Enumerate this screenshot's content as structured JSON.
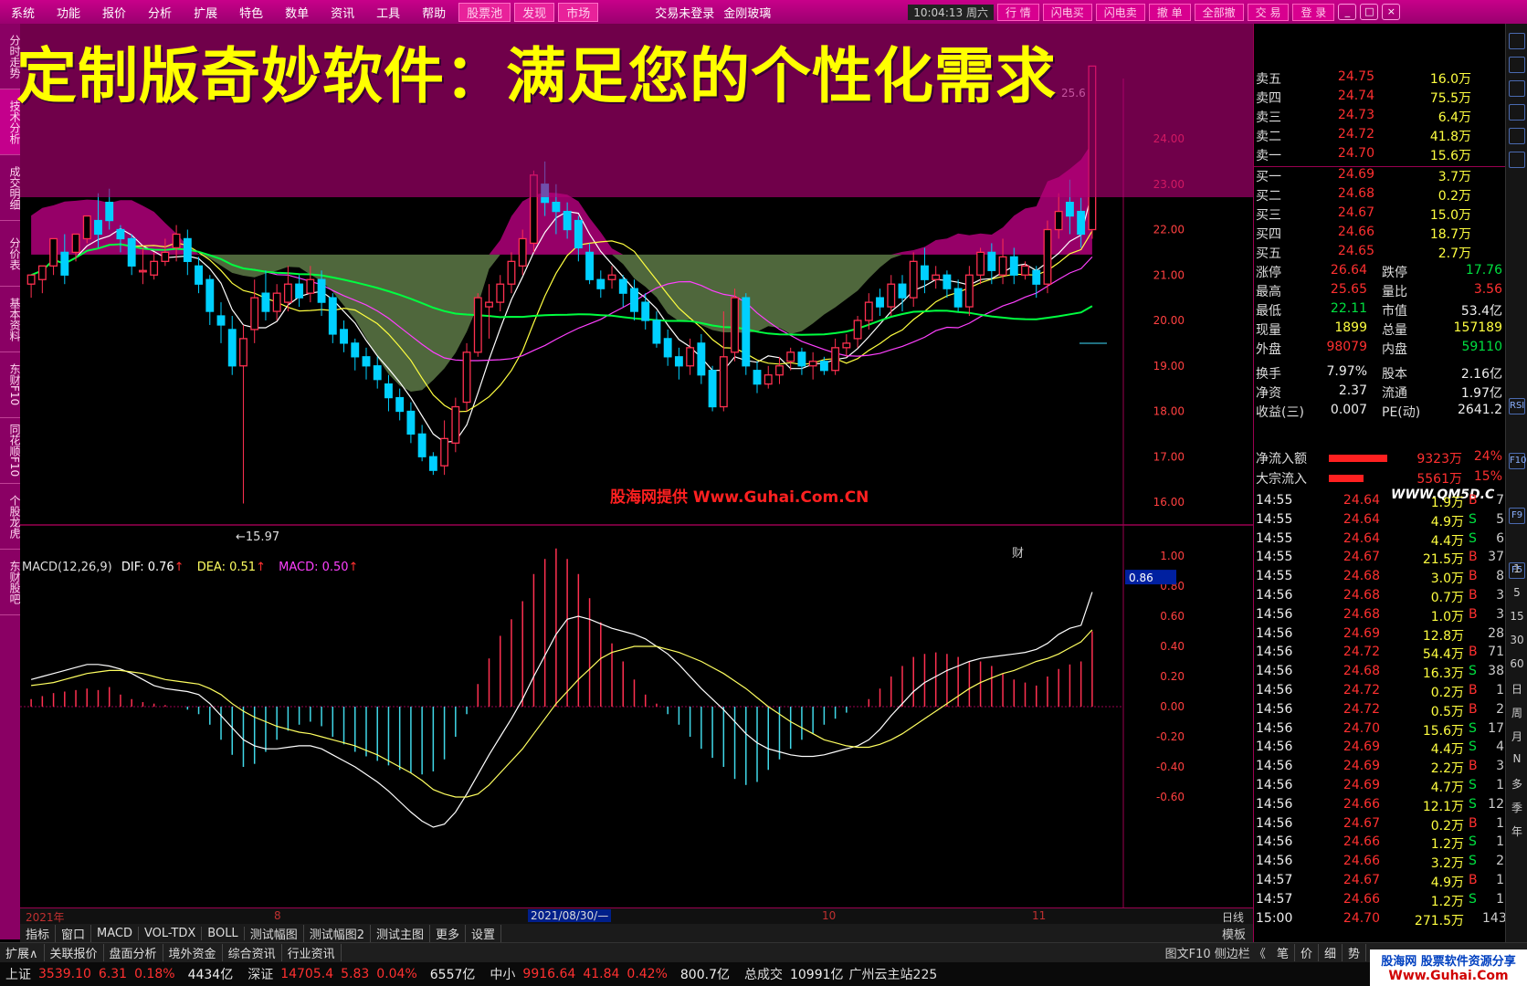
{
  "menu": {
    "items": [
      "系统",
      "功能",
      "报价",
      "分析",
      "扩展",
      "特色",
      "数单",
      "资讯",
      "工具",
      "帮助"
    ],
    "highlight_items": [
      "股票池",
      "发现",
      "市场"
    ],
    "login_status": "交易未登录",
    "stock_name": "金刚玻璃",
    "clock": "10:04:13 周六",
    "right_buttons": [
      "行 情",
      "闪电买",
      "闪电卖",
      "撤 单",
      "全部撤",
      "交 易",
      "登 录"
    ],
    "window_controls": [
      "_",
      "□",
      "×"
    ]
  },
  "left_tabs": [
    "分时走势",
    "技术分析",
    "成交明细",
    "分价表",
    "基本资料",
    "东财F10",
    "同花顺F10",
    "个股龙虎",
    "东财股吧"
  ],
  "banner": {
    "text": "定制版奇妙软件：满足您的个性化需求"
  },
  "chart": {
    "price_axis": [
      "24.00",
      "23.00",
      "22.00",
      "21.00",
      "20.00",
      "19.00",
      "18.00",
      "17.00",
      "16.00"
    ],
    "macd_axis": [
      "1.00",
      "0.80",
      "0.60",
      "0.40",
      "0.20",
      "0.00",
      "-0.20",
      "-0.40",
      "-0.60"
    ],
    "macd_current": "0.86",
    "top_label": "25.6",
    "low_label": "←15.97",
    "marker": "财",
    "watermark": "股海网提供 Www.Guhai.Com.CN",
    "macd_label": {
      "name": "MACD(12,26,9)",
      "dif": "DIF: 0.76",
      "dea": "DEA: 0.51",
      "macd": "MACD: 0.50",
      "arrow": "↑"
    },
    "x_labels": [
      "2021年",
      "8",
      "10",
      "11"
    ],
    "x_selected": "2021/08/30/—",
    "period_label": "日线",
    "colors": {
      "up": "#ff3050",
      "down": "#00d0ff",
      "ma5": "#ffffff",
      "ma10": "#ffff40",
      "ma20": "#ff40ff",
      "ma60": "#00ff40",
      "band_up": "#b0007a",
      "band_down": "#6a8a50"
    }
  },
  "tabs": [
    "指标",
    "窗口",
    "MACD",
    "VOL-TDX",
    "BOLL",
    "测试幅图",
    "测试幅图2",
    "测试主图",
    "更多",
    "设置"
  ],
  "tabs_right": "模板",
  "ext_tabs": [
    "扩展∧",
    "关联报价",
    "盘面分析",
    "境外资金",
    "综合资讯",
    "行业资讯"
  ],
  "ext_right": "图文F10 侧边栏 《",
  "ext_extra": [
    "笔",
    "价",
    "细",
    "势"
  ],
  "status": {
    "sh_label": "上证",
    "sh_value": "3539.10",
    "sh_change": "6.31",
    "sh_pct": "0.18%",
    "sh_amount": "4434亿",
    "sz_label": "深证",
    "sz_value": "14705.4",
    "sz_change": "5.83",
    "sz_pct": "0.04%",
    "sz_amount": "6557亿",
    "zx_label": "中小",
    "zx_value": "9916.64",
    "zx_change": "41.84",
    "zx_pct": "0.42%",
    "zx_amount": "800.7亿",
    "total_label": "总成交",
    "total_value": "10991亿",
    "site": "广州云主站225"
  },
  "brand": {
    "line1": "股海网 股票软件资源分享",
    "line2": "Www.Guhai.Com"
  },
  "quote": {
    "sells": [
      {
        "label": "卖五",
        "price": "24.75",
        "vol": "16.0万"
      },
      {
        "label": "卖四",
        "price": "24.74",
        "vol": "75.5万"
      },
      {
        "label": "卖三",
        "price": "24.73",
        "vol": "6.4万"
      },
      {
        "label": "卖二",
        "price": "24.72",
        "vol": "41.8万"
      },
      {
        "label": "卖一",
        "price": "24.70",
        "vol": "15.6万"
      }
    ],
    "buys": [
      {
        "label": "买一",
        "price": "24.69",
        "vol": "3.7万"
      },
      {
        "label": "买二",
        "price": "24.68",
        "vol": "0.2万"
      },
      {
        "label": "买三",
        "price": "24.67",
        "vol": "15.0万"
      },
      {
        "label": "买四",
        "price": "24.66",
        "vol": "18.7万"
      },
      {
        "label": "买五",
        "price": "24.65",
        "vol": "2.7万"
      }
    ],
    "stats": [
      {
        "l1": "涨停",
        "v1": "26.64",
        "c1": "#ff3030",
        "l2": "跌停",
        "v2": "17.76",
        "c2": "#00e040"
      },
      {
        "l1": "最高",
        "v1": "25.65",
        "c1": "#ff3030",
        "l2": "量比",
        "v2": "3.56",
        "c2": "#ff3030"
      },
      {
        "l1": "最低",
        "v1": "22.11",
        "c1": "#00e040",
        "l2": "市值",
        "v2": "53.4亿",
        "c2": "#eeeeee"
      },
      {
        "l1": "现量",
        "v1": "1899",
        "c1": "#ffff40",
        "l2": "总量",
        "v2": "157189",
        "c2": "#ffff40"
      },
      {
        "l1": "外盘",
        "v1": "98079",
        "c1": "#ff3030",
        "l2": "内盘",
        "v2": "59110",
        "c2": "#00e040"
      },
      {
        "l1": "换手",
        "v1": "7.97%",
        "c1": "#eeeeee",
        "l2": "股本",
        "v2": "2.16亿",
        "c2": "#eeeeee"
      },
      {
        "l1": "净资",
        "v1": "2.37",
        "c1": "#eeeeee",
        "l2": "流通",
        "v2": "1.97亿",
        "c2": "#eeeeee"
      },
      {
        "l1": "收益(三)",
        "v1": "0.007",
        "c1": "#eeeeee",
        "l2": "PE(动)",
        "v2": "2641.2",
        "c2": "#eeeeee"
      }
    ],
    "flows": [
      {
        "label": "净流入额",
        "value": "9323万",
        "pct": "24%"
      },
      {
        "label": "大宗流入",
        "value": "5561万",
        "pct": "15%"
      }
    ],
    "qm5d": "WWW.QM5D.C",
    "ticks": [
      {
        "t": "14:55",
        "p": "24.64",
        "pc": "#ff3030",
        "v": "1.9万",
        "bs": "B",
        "n": "7"
      },
      {
        "t": "14:55",
        "p": "24.64",
        "pc": "#ff3030",
        "v": "4.9万",
        "bs": "S",
        "n": "5"
      },
      {
        "t": "14:55",
        "p": "24.64",
        "pc": "#ff3030",
        "v": "4.4万",
        "bs": "S",
        "n": "6"
      },
      {
        "t": "14:55",
        "p": "24.67",
        "pc": "#ff3030",
        "v": "21.5万",
        "bs": "B",
        "n": "37"
      },
      {
        "t": "14:55",
        "p": "24.68",
        "pc": "#ff3030",
        "v": "3.0万",
        "bs": "B",
        "n": "8"
      },
      {
        "t": "14:56",
        "p": "24.68",
        "pc": "#ff3030",
        "v": "0.7万",
        "bs": "B",
        "n": "3"
      },
      {
        "t": "14:56",
        "p": "24.68",
        "pc": "#ff3030",
        "v": "1.0万",
        "bs": "B",
        "n": "3"
      },
      {
        "t": "14:56",
        "p": "24.69",
        "pc": "#ff3030",
        "v": "12.8万",
        "bs": "",
        "n": "28"
      },
      {
        "t": "14:56",
        "p": "24.72",
        "pc": "#ff3030",
        "v": "54.4万",
        "bs": "B",
        "n": "71"
      },
      {
        "t": "14:56",
        "p": "24.68",
        "pc": "#ff3030",
        "v": "16.3万",
        "bs": "S",
        "n": "38"
      },
      {
        "t": "14:56",
        "p": "24.72",
        "pc": "#ff3030",
        "v": "0.2万",
        "bs": "B",
        "n": "1"
      },
      {
        "t": "14:56",
        "p": "24.72",
        "pc": "#ff3030",
        "v": "0.5万",
        "bs": "B",
        "n": "2"
      },
      {
        "t": "14:56",
        "p": "24.70",
        "pc": "#ff3030",
        "v": "15.6万",
        "bs": "S",
        "n": "17"
      },
      {
        "t": "14:56",
        "p": "24.69",
        "pc": "#ff3030",
        "v": "4.4万",
        "bs": "S",
        "n": "4"
      },
      {
        "t": "14:56",
        "p": "24.69",
        "pc": "#ff3030",
        "v": "2.2万",
        "bs": "B",
        "n": "3"
      },
      {
        "t": "14:56",
        "p": "24.69",
        "pc": "#ff3030",
        "v": "4.7万",
        "bs": "S",
        "n": "1"
      },
      {
        "t": "14:56",
        "p": "24.66",
        "pc": "#ff3030",
        "v": "12.1万",
        "bs": "S",
        "n": "12"
      },
      {
        "t": "14:56",
        "p": "24.67",
        "pc": "#ff3030",
        "v": "0.2万",
        "bs": "B",
        "n": "1"
      },
      {
        "t": "14:56",
        "p": "24.66",
        "pc": "#ff3030",
        "v": "1.2万",
        "bs": "S",
        "n": "1"
      },
      {
        "t": "14:56",
        "p": "24.66",
        "pc": "#ff3030",
        "v": "3.2万",
        "bs": "S",
        "n": "2"
      },
      {
        "t": "14:57",
        "p": "24.67",
        "pc": "#ff3030",
        "v": "4.9万",
        "bs": "B",
        "n": "1"
      },
      {
        "t": "14:57",
        "p": "24.66",
        "pc": "#ff3030",
        "v": "1.2万",
        "bs": "S",
        "n": "1"
      },
      {
        "t": "15:00",
        "p": "24.70",
        "pc": "#ff3030",
        "v": "271.5万",
        "bs": "",
        "n": "143"
      }
    ]
  },
  "right_icons": [
    "RSI",
    "F10",
    "F9",
    "F5"
  ],
  "right_periods": [
    "1",
    "5",
    "15",
    "30",
    "60",
    "日",
    "周",
    "月",
    "N",
    "多",
    "季",
    "年"
  ],
  "candles": [
    [
      20.8,
      21.0,
      20.5,
      20.8
    ],
    [
      20.9,
      21.2,
      20.6,
      21.1
    ],
    [
      21.2,
      21.8,
      21.0,
      21.5
    ],
    [
      21.5,
      21.0,
      20.8,
      21.9
    ],
    [
      21.5,
      21.9,
      21.3,
      21.8
    ],
    [
      21.8,
      22.3,
      21.7,
      22.2
    ],
    [
      22.2,
      21.9,
      21.6,
      22.8
    ],
    [
      22.6,
      22.2,
      22.0,
      22.9
    ],
    [
      22.0,
      21.8,
      21.5,
      22.1
    ],
    [
      21.8,
      21.2,
      21.0,
      21.9
    ],
    [
      21.1,
      21.1,
      20.8,
      21.6
    ],
    [
      21.0,
      21.3,
      20.9,
      21.5
    ],
    [
      21.3,
      21.5,
      21.2,
      21.8
    ],
    [
      21.6,
      21.9,
      21.3,
      22.1
    ],
    [
      21.8,
      21.3,
      21.0,
      22.0
    ],
    [
      21.2,
      20.8,
      20.6,
      21.4
    ],
    [
      20.9,
      20.2,
      19.9,
      21.0
    ],
    [
      20.1,
      19.9,
      19.5,
      20.4
    ],
    [
      19.8,
      19.0,
      18.8,
      20.1
    ],
    [
      19.0,
      19.6,
      15.97,
      19.9
    ],
    [
      19.8,
      20.5,
      19.5,
      20.9
    ],
    [
      20.6,
      20.2,
      20.0,
      21.1
    ],
    [
      20.2,
      20.6,
      20.0,
      20.8
    ],
    [
      20.4,
      20.8,
      20.2,
      21.2
    ],
    [
      20.8,
      20.5,
      20.3,
      21.0
    ],
    [
      20.6,
      20.9,
      20.4,
      21.2
    ],
    [
      20.9,
      20.4,
      20.1,
      21.1
    ],
    [
      20.5,
      19.7,
      19.5,
      20.6
    ],
    [
      19.8,
      19.5,
      19.3,
      20.0
    ],
    [
      19.5,
      19.2,
      18.9,
      19.6
    ],
    [
      19.2,
      19.0,
      18.7,
      19.4
    ],
    [
      19.0,
      18.7,
      18.5,
      19.2
    ],
    [
      18.6,
      18.3,
      18.0,
      18.8
    ],
    [
      18.3,
      18.0,
      17.8,
      18.5
    ],
    [
      18.0,
      17.5,
      17.3,
      18.2
    ],
    [
      17.5,
      17.0,
      16.9,
      17.7
    ],
    [
      17.0,
      16.7,
      16.6,
      17.1
    ],
    [
      16.8,
      17.4,
      16.6,
      17.8
    ],
    [
      17.3,
      18.1,
      17.1,
      18.3
    ],
    [
      18.2,
      19.3,
      18.0,
      19.5
    ],
    [
      19.3,
      20.5,
      19.2,
      20.6
    ],
    [
      20.3,
      20.4,
      19.6,
      20.8
    ],
    [
      20.4,
      20.8,
      20.2,
      21.0
    ],
    [
      20.8,
      21.3,
      20.6,
      21.5
    ],
    [
      21.2,
      21.8,
      21.0,
      22.0
    ],
    [
      21.7,
      23.2,
      21.5,
      23.3
    ],
    [
      23.0,
      22.6,
      22.3,
      23.5
    ],
    [
      22.6,
      22.4,
      21.9,
      23.0
    ],
    [
      22.4,
      22.0,
      21.8,
      22.6
    ],
    [
      22.2,
      21.6,
      21.3,
      22.3
    ],
    [
      21.5,
      20.9,
      20.8,
      21.7
    ],
    [
      20.9,
      20.7,
      20.5,
      21.1
    ],
    [
      20.9,
      21.0,
      20.7,
      21.2
    ],
    [
      20.9,
      20.6,
      20.3,
      21.0
    ],
    [
      20.7,
      20.2,
      20.0,
      20.9
    ],
    [
      20.4,
      20.0,
      19.8,
      20.6
    ],
    [
      20.0,
      19.5,
      19.4,
      20.2
    ],
    [
      19.6,
      19.2,
      19.0,
      19.8
    ],
    [
      19.2,
      19.0,
      18.7,
      19.4
    ],
    [
      19.0,
      19.4,
      18.8,
      19.6
    ],
    [
      19.5,
      18.8,
      18.6,
      19.7
    ],
    [
      18.9,
      18.1,
      18.0,
      19.0
    ],
    [
      18.1,
      19.2,
      18.0,
      20.2
    ],
    [
      19.3,
      20.5,
      19.1,
      20.7
    ],
    [
      20.5,
      19.0,
      18.8,
      20.6
    ],
    [
      18.9,
      18.6,
      18.4,
      19.1
    ],
    [
      18.6,
      18.8,
      18.5,
      19.0
    ],
    [
      18.8,
      19.0,
      18.6,
      19.2
    ],
    [
      19.1,
      19.3,
      18.9,
      19.4
    ],
    [
      19.3,
      19.0,
      18.8,
      19.4
    ],
    [
      19.0,
      19.1,
      18.7,
      19.3
    ],
    [
      19.1,
      18.9,
      18.8,
      19.2
    ],
    [
      18.9,
      19.4,
      18.8,
      19.6
    ],
    [
      19.4,
      19.5,
      19.2,
      19.7
    ],
    [
      19.6,
      20.0,
      19.4,
      20.1
    ],
    [
      20.0,
      20.4,
      19.8,
      20.6
    ],
    [
      20.5,
      20.3,
      20.1,
      20.7
    ],
    [
      20.3,
      20.8,
      20.1,
      21.0
    ],
    [
      20.8,
      20.5,
      20.2,
      21.0
    ],
    [
      20.5,
      21.3,
      20.3,
      21.5
    ],
    [
      21.2,
      20.9,
      20.6,
      21.6
    ],
    [
      20.9,
      21.0,
      20.7,
      21.2
    ],
    [
      21.0,
      20.7,
      20.5,
      21.1
    ],
    [
      20.7,
      20.3,
      20.2,
      20.9
    ],
    [
      20.3,
      21.0,
      20.1,
      21.2
    ],
    [
      21.0,
      21.5,
      20.8,
      21.6
    ],
    [
      21.5,
      21.1,
      20.8,
      21.7
    ],
    [
      21.0,
      21.4,
      20.8,
      21.8
    ],
    [
      21.4,
      21.0,
      20.8,
      21.6
    ],
    [
      21.0,
      21.2,
      20.9,
      21.3
    ],
    [
      21.1,
      20.8,
      20.5,
      21.2
    ],
    [
      20.8,
      22.0,
      20.6,
      22.2
    ],
    [
      22.0,
      22.4,
      21.8,
      22.8
    ],
    [
      22.6,
      22.3,
      21.9,
      23.1
    ],
    [
      22.4,
      21.9,
      21.6,
      22.7
    ],
    [
      22.0,
      25.6,
      21.8,
      25.6
    ]
  ],
  "macd_hist": [
    0.05,
    0.07,
    0.09,
    0.1,
    0.11,
    0.12,
    0.11,
    0.13,
    0.08,
    0.05,
    0.03,
    0.02,
    0.01,
    0.0,
    -0.02,
    -0.05,
    -0.12,
    -0.22,
    -0.32,
    -0.4,
    -0.38,
    -0.3,
    -0.22,
    -0.16,
    -0.12,
    -0.1,
    -0.13,
    -0.2,
    -0.25,
    -0.3,
    -0.33,
    -0.36,
    -0.39,
    -0.42,
    -0.44,
    -0.45,
    -0.43,
    -0.35,
    -0.2,
    -0.05,
    0.15,
    0.32,
    0.47,
    0.58,
    0.7,
    0.88,
    0.98,
    1.05,
    0.98,
    0.88,
    0.72,
    0.56,
    0.42,
    0.3,
    0.18,
    0.08,
    0.02,
    -0.05,
    -0.12,
    -0.2,
    -0.28,
    -0.34,
    -0.4,
    -0.48,
    -0.52,
    -0.5,
    -0.42,
    -0.35,
    -0.28,
    -0.22,
    -0.18,
    -0.12,
    -0.08,
    -0.04,
    0.0,
    0.05,
    0.12,
    0.2,
    0.27,
    0.33,
    0.35,
    0.36,
    0.35,
    0.33,
    0.3,
    0.3,
    0.27,
    0.22,
    0.18,
    0.16,
    0.14,
    0.2,
    0.25,
    0.28,
    0.3,
    0.5
  ],
  "macd_dif": [
    0.18,
    0.2,
    0.22,
    0.24,
    0.26,
    0.28,
    0.28,
    0.27,
    0.25,
    0.22,
    0.18,
    0.14,
    0.12,
    0.11,
    0.1,
    0.08,
    0.02,
    -0.06,
    -0.14,
    -0.22,
    -0.26,
    -0.28,
    -0.28,
    -0.27,
    -0.26,
    -0.26,
    -0.28,
    -0.32,
    -0.36,
    -0.4,
    -0.45,
    -0.5,
    -0.56,
    -0.63,
    -0.7,
    -0.76,
    -0.8,
    -0.78,
    -0.7,
    -0.58,
    -0.45,
    -0.32,
    -0.2,
    -0.08,
    0.05,
    0.2,
    0.34,
    0.48,
    0.58,
    0.6,
    0.58,
    0.55,
    0.52,
    0.5,
    0.48,
    0.45,
    0.4,
    0.35,
    0.28,
    0.2,
    0.12,
    0.05,
    -0.02,
    -0.1,
    -0.18,
    -0.24,
    -0.28,
    -0.3,
    -0.32,
    -0.33,
    -0.33,
    -0.32,
    -0.3,
    -0.28,
    -0.26,
    -0.22,
    -0.15,
    -0.06,
    0.02,
    0.1,
    0.16,
    0.2,
    0.24,
    0.27,
    0.3,
    0.32,
    0.33,
    0.34,
    0.35,
    0.36,
    0.38,
    0.42,
    0.48,
    0.52,
    0.54,
    0.76
  ],
  "macd_dea": [
    0.14,
    0.15,
    0.16,
    0.18,
    0.2,
    0.22,
    0.23,
    0.24,
    0.24,
    0.23,
    0.22,
    0.2,
    0.18,
    0.17,
    0.16,
    0.15,
    0.12,
    0.08,
    0.02,
    -0.03,
    -0.07,
    -0.1,
    -0.13,
    -0.15,
    -0.17,
    -0.18,
    -0.2,
    -0.22,
    -0.24,
    -0.26,
    -0.29,
    -0.32,
    -0.36,
    -0.4,
    -0.44,
    -0.49,
    -0.55,
    -0.58,
    -0.6,
    -0.6,
    -0.58,
    -0.52,
    -0.44,
    -0.36,
    -0.28,
    -0.18,
    -0.08,
    0.02,
    0.1,
    0.18,
    0.25,
    0.32,
    0.36,
    0.38,
    0.4,
    0.4,
    0.4,
    0.38,
    0.36,
    0.33,
    0.3,
    0.26,
    0.22,
    0.17,
    0.12,
    0.06,
    0.0,
    -0.05,
    -0.1,
    -0.14,
    -0.18,
    -0.22,
    -0.24,
    -0.26,
    -0.27,
    -0.27,
    -0.25,
    -0.22,
    -0.18,
    -0.13,
    -0.08,
    -0.03,
    0.02,
    0.07,
    0.12,
    0.16,
    0.19,
    0.22,
    0.24,
    0.27,
    0.3,
    0.32,
    0.35,
    0.39,
    0.43,
    0.51
  ]
}
